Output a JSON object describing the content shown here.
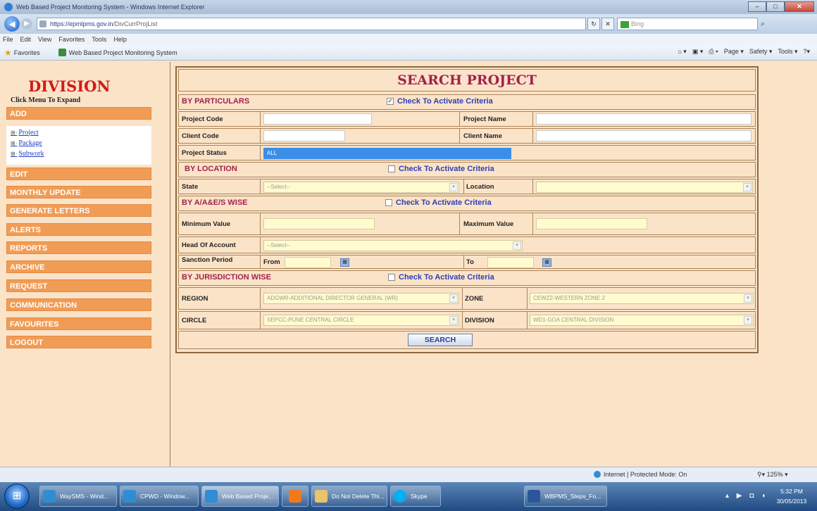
{
  "window": {
    "title": "Web Based Project Monitoring System - Windows Internet Explorer",
    "buttons": {
      "min": "–",
      "max": "□",
      "close": "✕"
    }
  },
  "address": {
    "url_host": "https://epmlpms.gov.in",
    "url_path": "/DivCurrProjList",
    "search_placeholder": "Bing"
  },
  "menubar": [
    "File",
    "Edit",
    "View",
    "Favorites",
    "Tools",
    "Help"
  ],
  "favbar": {
    "favorites_label": "Favorites",
    "tab_title": "Web Based Project Monitoring System",
    "commands": [
      "Page ▾",
      "Safety ▾",
      "Tools ▾"
    ]
  },
  "sidebar": {
    "brand": "DIVISION",
    "hint": "Click Menu To Expand",
    "add_label": "ADD",
    "submenu": [
      "Project",
      "Package",
      "Subwork"
    ],
    "menus": [
      "EDIT",
      "MONTHLY UPDATE",
      "GENERATE LETTERS",
      "ALERTS",
      "REPORTS",
      "ARCHIVE",
      "REQUEST",
      "COMMUNICATION",
      "FAVOURITES",
      "LOGOUT"
    ]
  },
  "search": {
    "title": "SEARCH PROJECT",
    "criteria_label": "Check To Activate Criteria",
    "sections": {
      "particulars": "BY PARTICULARS",
      "location": "BY LOCATION",
      "aas": "BY A/A&E/S WISE",
      "jurisdiction": "BY JURISDICTION WISE"
    },
    "labels": {
      "project_code": "Project Code",
      "project_name": "Project Name",
      "client_code": "Client Code",
      "client_name": "Client Name",
      "project_status": "Project Status",
      "state": "State",
      "location": "Location",
      "min_value": "Minimum Value",
      "max_value": "Maximum Value",
      "head_of_account": "Head Of Account",
      "sanction_period": "Sanction Period",
      "from": "From",
      "to": "To",
      "region": "REGION",
      "zone": "ZONE",
      "circle": "CIRCLE",
      "division": "DIVISION"
    },
    "values": {
      "project_status": "ALL",
      "state": "--Select--",
      "head_of_account": "--Select--",
      "region": "ADGWR-ADDITIONAL DIRECTOR GENERAL (WR)",
      "zone": "CEWZ2-WESTERN ZONE 2",
      "circle": "SEPCC-PUNE CENTRAL CIRCLE",
      "division": "WD1-GOA CENTRAL DIVISION"
    },
    "button": "SEARCH"
  },
  "statusbar": {
    "zone": "Internet | Protected Mode: On",
    "zoom": "125%"
  },
  "taskbar": {
    "tasks": [
      "WaySMS - Wind...",
      "CPWD - Window...",
      "Web Based Proje...",
      "",
      "Do Not Delete Thi...",
      "Skype",
      "WBPMS_Steps_Fo..."
    ],
    "time": "5:32 PM",
    "date": "30/05/2013"
  },
  "colors": {
    "page_bg": "#fbe3c8",
    "menu_orange": "#f19c55",
    "brand_red": "#d21a1a",
    "section_maroon": "#a0224c",
    "criteria_blue": "#2b3fb8"
  }
}
